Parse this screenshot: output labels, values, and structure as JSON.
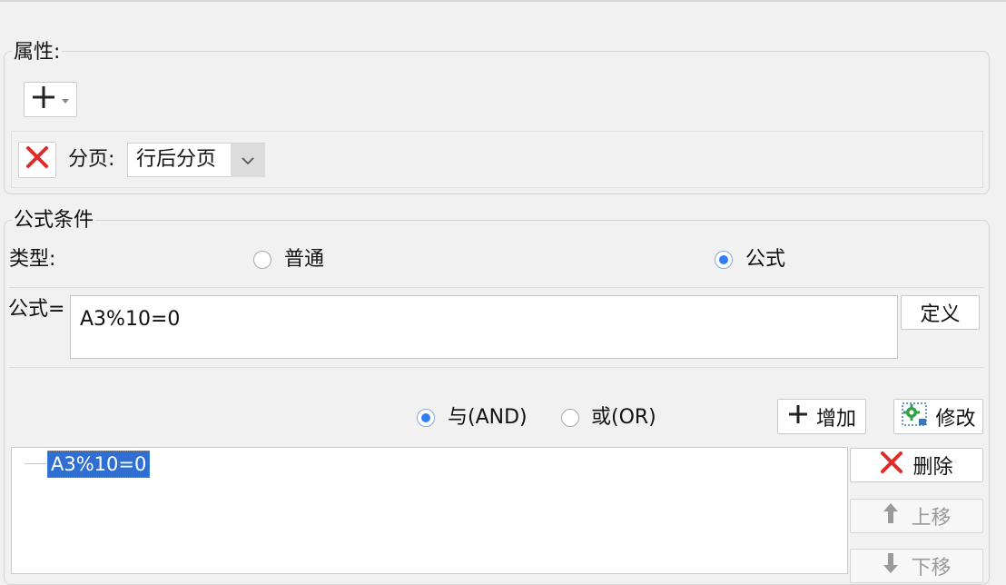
{
  "properties": {
    "legend": "属性:",
    "pagination_label": "分页:",
    "pagination_value": "行后分页"
  },
  "formula_condition": {
    "legend": "公式条件",
    "type_label": "类型:",
    "type_options": [
      {
        "label": "普通",
        "checked": false
      },
      {
        "label": "公式",
        "checked": true
      }
    ],
    "formula_label": "公式=",
    "formula_value": "A3%10=0",
    "define_button": "定义",
    "logic_options": [
      {
        "label": "与(AND)",
        "checked": true
      },
      {
        "label": "或(OR)",
        "checked": false
      }
    ],
    "add_button": "增加",
    "modify_button": "修改",
    "delete_button": "删除",
    "move_up_button": "上移",
    "move_down_button": "下移",
    "tree_items": [
      "A3%10=0"
    ]
  },
  "colors": {
    "accent": "#2f7ff5",
    "delete_red": "#e02b2b",
    "selection_bg": "#2f6fd1"
  }
}
